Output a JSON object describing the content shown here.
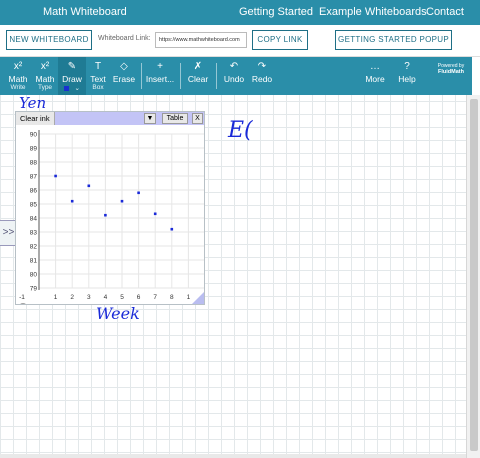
{
  "topnav": {
    "brand": "Math Whiteboard",
    "getting_started": "Getting Started",
    "examples": "Example Whiteboards",
    "contact": "Contact"
  },
  "linkbar": {
    "new_whiteboard": "NEW WHITEBOARD",
    "link_label": "Whiteboard Link:",
    "url": "https://www.mathwhiteboard.com",
    "copy_link": "COPY LINK",
    "getting_started_popup": "GETTING STARTED POPUP"
  },
  "toolbar": {
    "math_write": {
      "l1": "Math",
      "l2": "Write"
    },
    "math_type": {
      "l1": "Math",
      "l2": "Type"
    },
    "draw": {
      "l1": "Draw"
    },
    "text_box": {
      "l1": "Text",
      "l2": "Box"
    },
    "erase": {
      "l1": "Erase"
    },
    "insert": {
      "l1": "Insert..."
    },
    "clear": {
      "l1": "Clear"
    },
    "undo": {
      "l1": "Undo"
    },
    "redo": {
      "l1": "Redo"
    },
    "more": {
      "l1": "More"
    },
    "help": {
      "l1": "Help"
    },
    "powered_a": "Powered by",
    "powered_b": "FluidMath",
    "draw_color": "#1a2ad8"
  },
  "sidetab": ">>",
  "handwriting": {
    "y_label": "Yen",
    "x_label": "Week",
    "note": "E("
  },
  "graph": {
    "clear_ink": "Clear ink",
    "dropdown": "▼",
    "table": "Table",
    "close": "X",
    "zoom_button": "A"
  },
  "chart_data": {
    "type": "scatter",
    "x_ticks": [
      "-1",
      "1",
      "2",
      "3",
      "4",
      "5",
      "6",
      "7",
      "8",
      "1"
    ],
    "y_ticks": [
      "79",
      "80",
      "81",
      "82",
      "83",
      "84",
      "85",
      "86",
      "87",
      "88",
      "89",
      "90"
    ],
    "ylim": [
      79,
      90
    ],
    "points": [
      {
        "x": 1,
        "y": 87
      },
      {
        "x": 2,
        "y": 85.2
      },
      {
        "x": 3,
        "y": 86.3
      },
      {
        "x": 4,
        "y": 84.2
      },
      {
        "x": 5,
        "y": 85.2
      },
      {
        "x": 6,
        "y": 85.8
      },
      {
        "x": 7,
        "y": 84.3
      },
      {
        "x": 8,
        "y": 83.2
      }
    ],
    "point_color": "#1a2ad8"
  }
}
